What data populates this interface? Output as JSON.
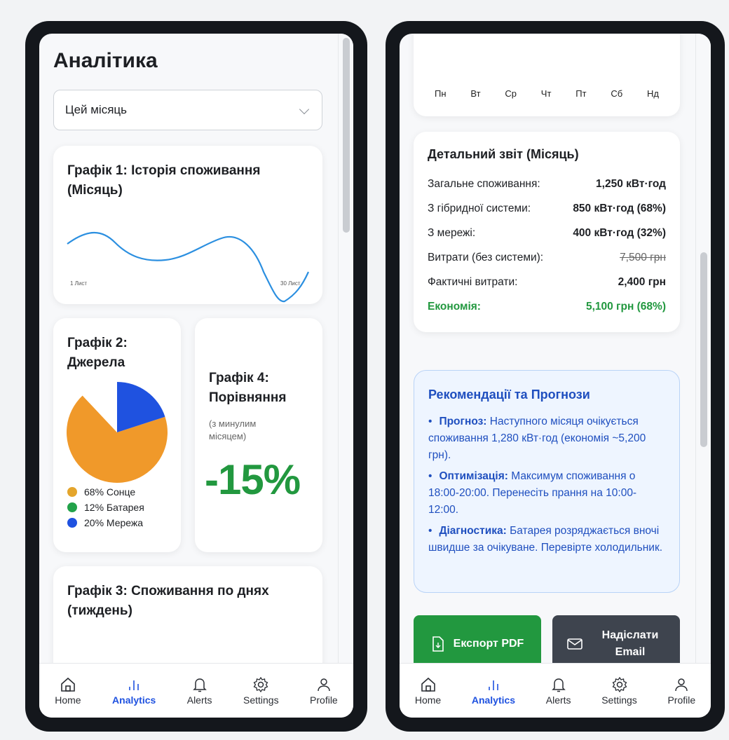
{
  "left": {
    "title": "Аналітика",
    "period_select": "Цей місяць",
    "chart1": {
      "title": "Графік 1: Історія споживання (Місяць)",
      "x_start": "1 Лист",
      "x_end": "30 Лист"
    },
    "chart2": {
      "title": "Графік 2: Джерела",
      "legend": [
        {
          "label": "68% Сонце",
          "color": "#e4a52c"
        },
        {
          "label": "12% Батарея",
          "color": "#22a24a"
        },
        {
          "label": "20% Мережа",
          "color": "#1f52e0"
        }
      ]
    },
    "chart4": {
      "title": "Графік 4: Порівняння",
      "subtitle": "(з минулим місяцем)",
      "value": "-15%"
    },
    "chart3": {
      "title": "Графік 3: Споживання по днях (тиждень)"
    }
  },
  "right": {
    "weekdays": [
      "Пн",
      "Вт",
      "Ср",
      "Чт",
      "Пт",
      "Сб",
      "Нд"
    ],
    "report": {
      "title": "Детальний звіт (Місяць)",
      "rows": [
        {
          "label": "Загальне споживання:",
          "value": "1,250 кВт·год"
        },
        {
          "label": "З гібридної системи:",
          "value": "850 кВт·год (68%)"
        },
        {
          "label": "З мережі:",
          "value": "400 кВт·год (32%)"
        },
        {
          "label": "Витрати (без системи):",
          "value": "7,500 грн"
        },
        {
          "label": "Фактичні витрати:",
          "value": "2,400 грн"
        },
        {
          "label": "Економія:",
          "value": "5,100 грн (68%)"
        }
      ]
    },
    "reco": {
      "title": "Рекомендації та Прогнози",
      "items": [
        {
          "bullet": "•",
          "head": "Прогноз:",
          "text": " Наступного місяця очікується споживання 1,280 кВт·год (економія ~5,200 грн)."
        },
        {
          "bullet": "•",
          "head": "Оптимізація:",
          "text": " Максимум споживання о 18:00-20:00. Перенесіть прання на 10:00-12:00."
        },
        {
          "bullet": "•",
          "head": "Діагностика:",
          "text": " Батарея розряджається вночі швидше за очікуване. Перевірте холодильник."
        }
      ]
    },
    "export_button": "Експорт PDF",
    "email_button": "Надіслати Email"
  },
  "tabs": {
    "home": "Home",
    "analytics": "Analytics",
    "alerts": "Alerts",
    "settings": "Settings",
    "profile": "Profile"
  },
  "chart_data": {
    "type": "pie",
    "title": "Графік 2: Джерела",
    "categories": [
      "Сонце",
      "Батарея",
      "Мережа"
    ],
    "values": [
      68,
      12,
      20
    ],
    "colors": [
      "#f0992a",
      "#22a24a",
      "#1f52e0"
    ]
  },
  "colors": {
    "accent": "#1f52e0",
    "success": "#22a24a",
    "export_button": "#22983f",
    "email_button": "#3e444e"
  }
}
